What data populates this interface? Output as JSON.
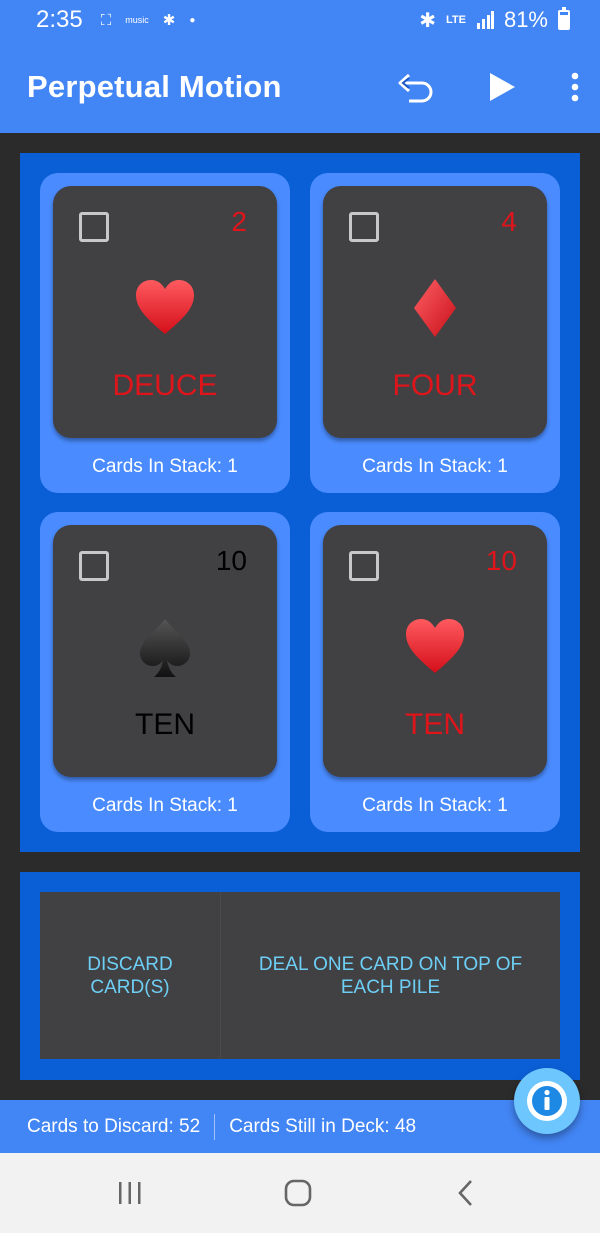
{
  "status_bar": {
    "time": "2:35",
    "battery_text": "81%",
    "network": "LTE",
    "icons": [
      "screenshot-icon",
      "music-icon",
      "slack-icon",
      "dot-icon",
      "bluetooth-icon",
      "signal-icon",
      "battery-icon"
    ]
  },
  "app_bar": {
    "title": "Perpetual Motion",
    "actions": [
      "undo-icon",
      "play-icon",
      "more-vert-icon"
    ],
    "color": "#4285f4"
  },
  "piles": [
    {
      "rank": "2",
      "rank_name": "DEUCE",
      "suit": "heart",
      "color": "#e0151b",
      "stack_label": "Cards In Stack: 1"
    },
    {
      "rank": "4",
      "rank_name": "FOUR",
      "suit": "diamond",
      "color": "#e0151b",
      "stack_label": "Cards In Stack: 1"
    },
    {
      "rank": "10",
      "rank_name": "TEN",
      "suit": "spade",
      "color": "#000000",
      "stack_label": "Cards In Stack: 1"
    },
    {
      "rank": "10",
      "rank_name": "TEN",
      "suit": "heart",
      "color": "#e0151b",
      "stack_label": "Cards In Stack: 1"
    }
  ],
  "actions": {
    "discard_label": "DISCARD CARD(S)",
    "deal_label": "DEAL ONE CARD ON TOP OF EACH PILE"
  },
  "footer": {
    "discard_text": "Cards to Discard: 52",
    "deck_text": "Cards Still in Deck: 48"
  },
  "fab": {
    "icon": "info-icon"
  },
  "nav_bar": {
    "buttons": [
      "recents-icon",
      "home-icon",
      "back-icon"
    ]
  }
}
